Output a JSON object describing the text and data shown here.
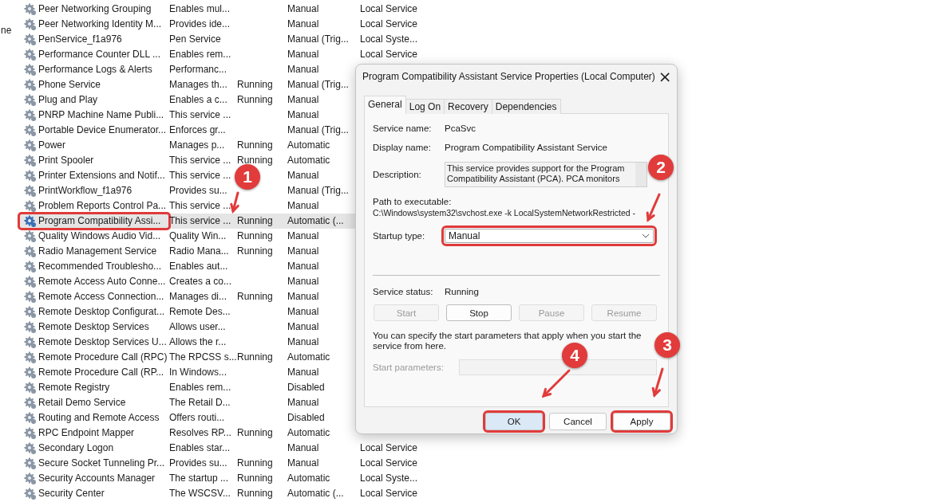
{
  "left_pane_fragments": [
    "ne"
  ],
  "services": [
    {
      "name": "Peer Networking Grouping",
      "description": "Enables mul...",
      "startup": "Manual",
      "logon": "Local Service",
      "selected": false
    },
    {
      "name": "Peer Networking Identity M...",
      "description": "Provides ide...",
      "startup": "Manual",
      "logon": "Local Service",
      "selected": false
    },
    {
      "name": "PenService_f1a976",
      "description": "Pen Service",
      "startup": "Manual (Trig...",
      "logon": "Local Syste...",
      "selected": false
    },
    {
      "name": "Performance Counter DLL ...",
      "description": "Enables rem...",
      "startup": "Manual",
      "logon": "Local Service",
      "selected": false
    },
    {
      "name": "Performance Logs & Alerts",
      "description": "Performanc...",
      "startup": "Manual",
      "selected": false
    },
    {
      "name": "Phone Service",
      "description": "Manages th...",
      "status": "Running",
      "startup": "Manual (Trig...",
      "selected": false
    },
    {
      "name": "Plug and Play",
      "description": "Enables a c...",
      "status": "Running",
      "startup": "Manual",
      "selected": false
    },
    {
      "name": "PNRP Machine Name Publi...",
      "description": "This service ...",
      "startup": "Manual",
      "selected": false
    },
    {
      "name": "Portable Device Enumerator...",
      "description": "Enforces gr...",
      "startup": "Manual (Trig...",
      "selected": false
    },
    {
      "name": "Power",
      "description": "Manages p...",
      "status": "Running",
      "startup": "Automatic",
      "selected": false
    },
    {
      "name": "Print Spooler",
      "description": "This service ...",
      "status": "Running",
      "startup": "Automatic",
      "selected": false
    },
    {
      "name": "Printer Extensions and Notif...",
      "description": "This service ...",
      "startup": "Manual",
      "selected": false
    },
    {
      "name": "PrintWorkflow_f1a976",
      "description": "Provides su...",
      "startup": "Manual (Trig...",
      "selected": false
    },
    {
      "name": "Problem Reports Control Pa...",
      "description": "This service ...",
      "startup": "Manual",
      "selected": false
    },
    {
      "name": "Program Compatibility Assi...",
      "description": "This service ...",
      "status": "Running",
      "startup": "Automatic (...",
      "selected": true,
      "highlighted": true
    },
    {
      "name": "Quality Windows Audio Vid...",
      "description": "Quality Win...",
      "status": "Running",
      "startup": "Manual",
      "selected": false
    },
    {
      "name": "Radio Management Service",
      "description": "Radio Mana...",
      "status": "Running",
      "startup": "Manual",
      "selected": false
    },
    {
      "name": "Recommended Troublesho...",
      "description": "Enables aut...",
      "startup": "Manual",
      "selected": false
    },
    {
      "name": "Remote Access Auto Conne...",
      "description": "Creates a co...",
      "startup": "Manual",
      "selected": false
    },
    {
      "name": "Remote Access Connection...",
      "description": "Manages di...",
      "status": "Running",
      "startup": "Manual",
      "selected": false
    },
    {
      "name": "Remote Desktop Configurat...",
      "description": "Remote Des...",
      "startup": "Manual",
      "selected": false
    },
    {
      "name": "Remote Desktop Services",
      "description": "Allows user...",
      "startup": "Manual",
      "selected": false
    },
    {
      "name": "Remote Desktop Services U...",
      "description": "Allows the r...",
      "startup": "Manual",
      "selected": false
    },
    {
      "name": "Remote Procedure Call (RPC)",
      "description": "The RPCSS s...",
      "status": "Running",
      "startup": "Automatic",
      "selected": false
    },
    {
      "name": "Remote Procedure Call (RP...",
      "description": "In Windows...",
      "startup": "Manual",
      "selected": false
    },
    {
      "name": "Remote Registry",
      "description": "Enables rem...",
      "startup": "Disabled",
      "selected": false
    },
    {
      "name": "Retail Demo Service",
      "description": "The Retail D...",
      "startup": "Manual",
      "selected": false
    },
    {
      "name": "Routing and Remote Access",
      "description": "Offers routi...",
      "startup": "Disabled",
      "selected": false
    },
    {
      "name": "RPC Endpoint Mapper",
      "description": "Resolves RP...",
      "status": "Running",
      "startup": "Automatic",
      "selected": false
    },
    {
      "name": "Secondary Logon",
      "description": "Enables star...",
      "startup": "Manual",
      "logon": "Local Service",
      "selected": false
    },
    {
      "name": "Secure Socket Tunneling Pr...",
      "description": "Provides su...",
      "status": "Running",
      "startup": "Manual",
      "logon": "Local Service",
      "selected": false
    },
    {
      "name": "Security Accounts Manager",
      "description": "The startup ...",
      "status": "Running",
      "startup": "Automatic",
      "logon": "Local Syste...",
      "selected": false
    },
    {
      "name": "Security Center",
      "description": "The WSCSV...",
      "status": "Running",
      "startup": "Automatic (...",
      "logon": "Local Service",
      "selected": false
    }
  ],
  "dialog": {
    "title": "Program Compatibility Assistant Service Properties (Local Computer)",
    "close": "×",
    "tabs": [
      {
        "label": "General",
        "selected": true
      },
      {
        "label": "Log On",
        "selected": false
      },
      {
        "label": "Recovery",
        "selected": false
      },
      {
        "label": "Dependencies",
        "selected": false
      }
    ],
    "fields": [
      {
        "label": "Service name:",
        "value": "PcaSvc"
      },
      {
        "label": "Display name:",
        "value": "Program Compatibility Assistant Service"
      }
    ],
    "description": {
      "label": "Description:",
      "value": "This service provides support for the Program Compatibility Assistant (PCA).  PCA monitors"
    },
    "path": {
      "label": "Path to executable:",
      "value": "C:\\Windows\\system32\\svchost.exe -k LocalSystemNetworkRestricted -"
    },
    "startup_type": {
      "label": "Startup type:",
      "value": "Manual",
      "highlighted": true
    },
    "service_status": {
      "label": "Service status:",
      "value": "Running"
    },
    "service_buttons": [
      {
        "label": "Start",
        "disabled": true
      },
      {
        "label": "Stop",
        "disabled": false
      },
      {
        "label": "Pause",
        "disabled": true
      },
      {
        "label": "Resume",
        "disabled": true
      }
    ],
    "hint": "You can specify the start parameters that apply when you start the service from here.",
    "start_parameters": {
      "label": "Start parameters:",
      "disabled": true
    },
    "buttons": [
      {
        "label": "OK",
        "kind": "default",
        "highlighted": true
      },
      {
        "label": "Cancel",
        "kind": "normal",
        "highlighted": false
      },
      {
        "label": "Apply",
        "kind": "normal",
        "highlighted": true
      }
    ]
  },
  "callouts": [
    "1",
    "2",
    "3",
    "4"
  ]
}
